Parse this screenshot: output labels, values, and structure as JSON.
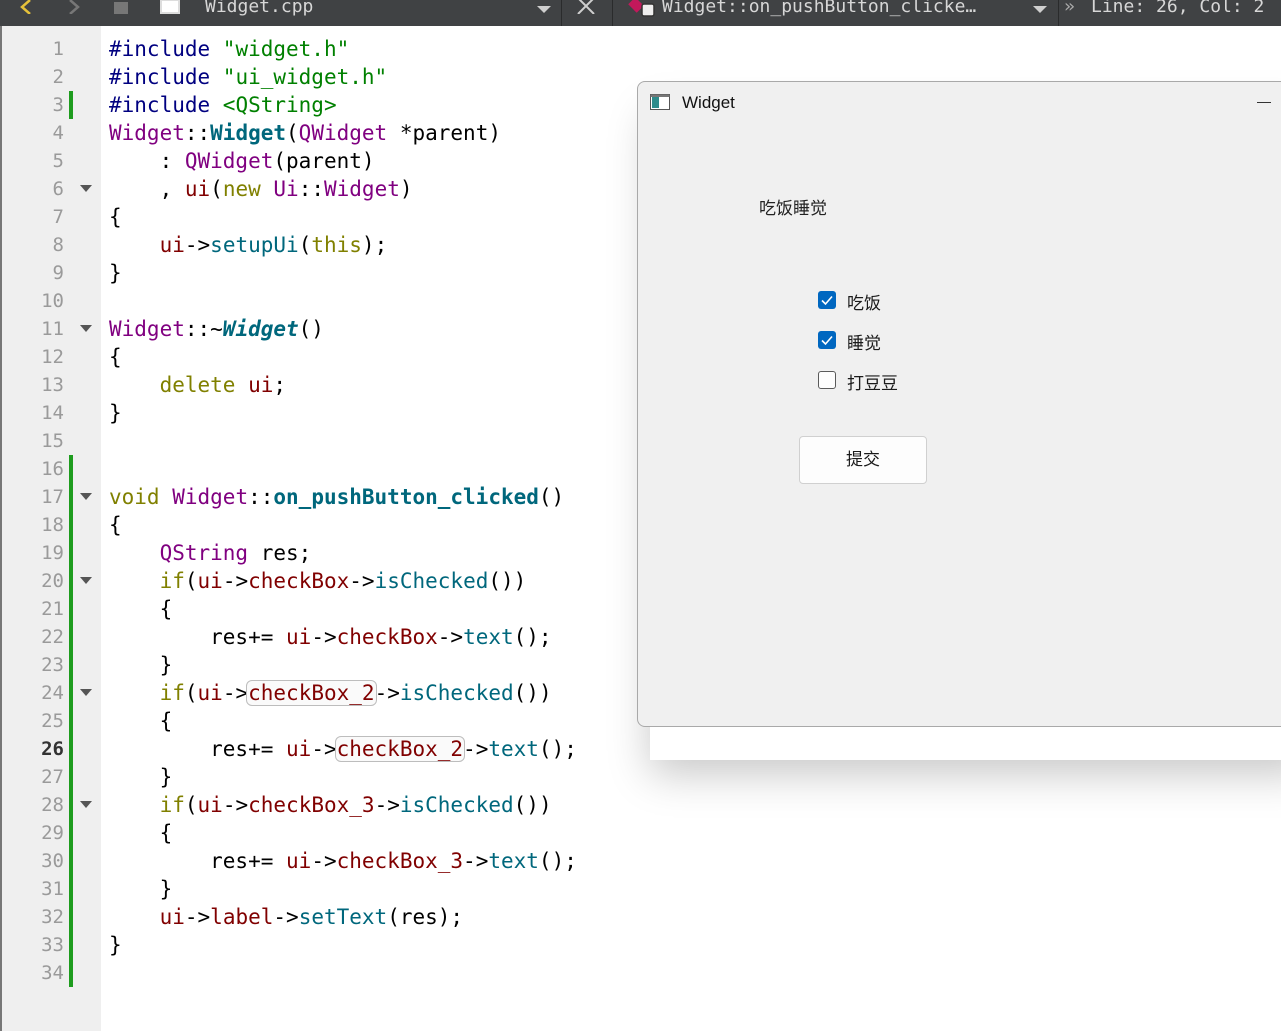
{
  "toolbar": {
    "file_name": "Widget.cpp",
    "symbol": "Widget::on_pushButton_clicke…",
    "position": "Line: 26, Col: 2"
  },
  "editor": {
    "current_line": 26,
    "line_numbers": [
      "1",
      "2",
      "3",
      "4",
      "5",
      "6",
      "7",
      "8",
      "9",
      "10",
      "11",
      "12",
      "13",
      "14",
      "15",
      "16",
      "17",
      "18",
      "19",
      "20",
      "21",
      "22",
      "23",
      "24",
      "25",
      "26",
      "27",
      "28",
      "29",
      "30",
      "31",
      "32",
      "33",
      "34"
    ],
    "lines": [
      "#include \"widget.h\"",
      "#include \"ui_widget.h\"",
      "#include <QString>",
      "Widget::Widget(QWidget *parent)",
      "    : QWidget(parent)",
      "    , ui(new Ui::Widget)",
      "{",
      "    ui->setupUi(this);",
      "}",
      "",
      "Widget::~Widget()",
      "{",
      "    delete ui;",
      "}",
      "",
      "",
      "void Widget::on_pushButton_clicked()",
      "{",
      "    QString res;",
      "    if(ui->checkBox->isChecked())",
      "    {",
      "        res+= ui->checkBox->text();",
      "    }",
      "    if(ui->checkBox_2->isChecked())",
      "    {",
      "        res+= ui->checkBox_2->text();",
      "    }",
      "    if(ui->checkBox_3->isChecked())",
      "    {",
      "        res+= ui->checkBox_3->text();",
      "    }",
      "    ui->label->setText(res);",
      "}",
      ""
    ]
  },
  "widget_window": {
    "title": "Widget",
    "label_text": "吃饭睡觉",
    "checkboxes": [
      {
        "label": "吃饭",
        "checked": true
      },
      {
        "label": "睡觉",
        "checked": true
      },
      {
        "label": "打豆豆",
        "checked": false
      }
    ],
    "submit_label": "提交",
    "accent_color": "#0067c0"
  }
}
